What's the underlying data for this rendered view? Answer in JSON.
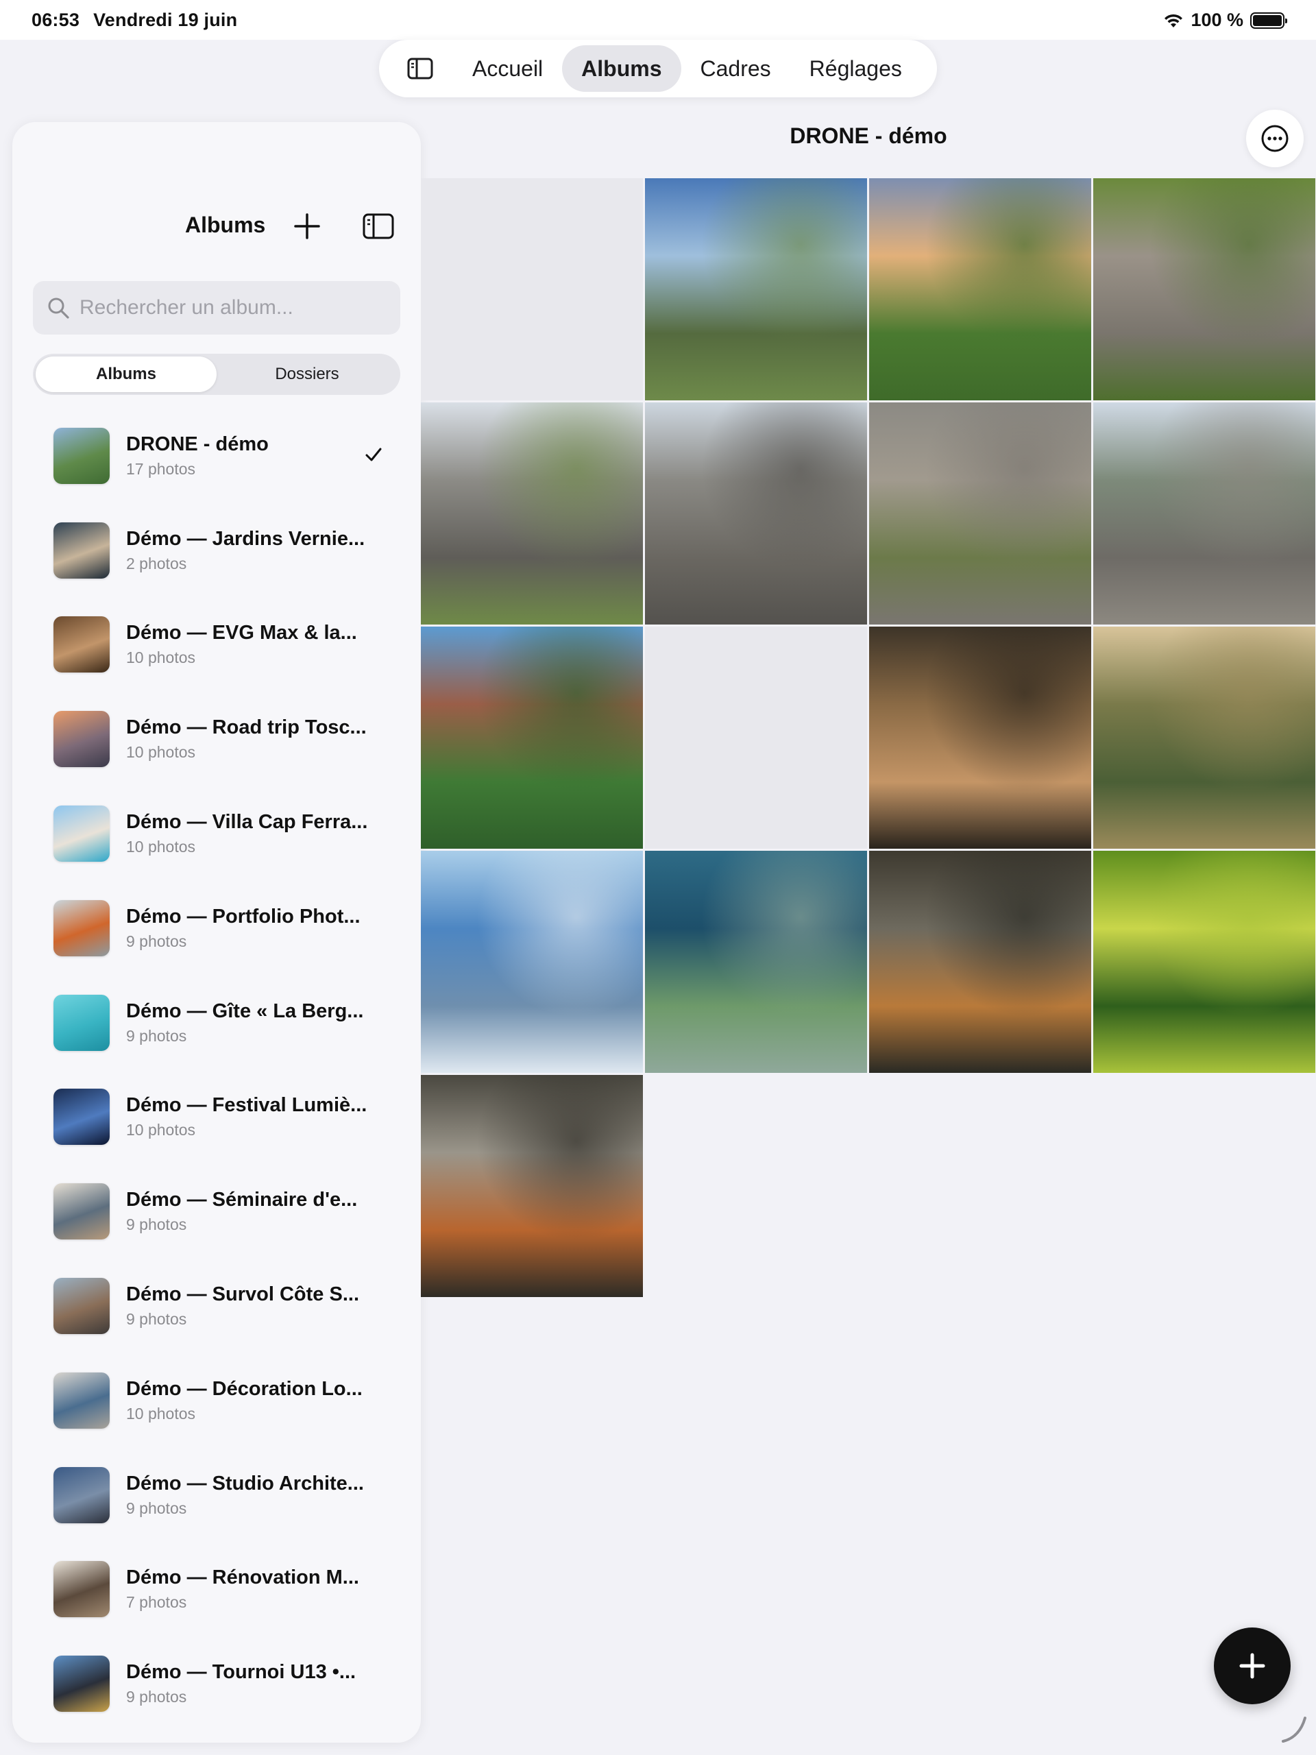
{
  "status_bar": {
    "time": "06:53",
    "date": "Vendredi 19 juin",
    "battery": "100 %"
  },
  "tabs": [
    {
      "label": "Accueil",
      "active": false
    },
    {
      "label": "Albums",
      "active": true
    },
    {
      "label": "Cadres",
      "active": false
    },
    {
      "label": "Réglages",
      "active": false
    }
  ],
  "sidebar": {
    "title": "Albums",
    "search_placeholder": "Rechercher un album...",
    "segments": [
      "Albums",
      "Dossiers"
    ],
    "albums": [
      {
        "name": "DRONE - démo",
        "count": "17 photos",
        "selected": true,
        "colors": [
          "#8fb3d9",
          "#5f8a4a",
          "#3f6b33"
        ]
      },
      {
        "name": "Démo — Jardins Vernie...",
        "count": "2 photos",
        "colors": [
          "#2f4253",
          "#c7b49a",
          "#1d2a36"
        ]
      },
      {
        "name": "Démo — EVG Max & la...",
        "count": "10 photos",
        "colors": [
          "#6b4a2e",
          "#c2956a",
          "#3a2817"
        ]
      },
      {
        "name": "Démo — Road trip Tosc...",
        "count": "10 photos",
        "colors": [
          "#e79b6a",
          "#7d6a78",
          "#3b3a4a"
        ]
      },
      {
        "name": "Démo — Villa Cap Ferra...",
        "count": "10 photos",
        "colors": [
          "#8ec6ee",
          "#e9e2d8",
          "#2ea7c9"
        ]
      },
      {
        "name": "Démo — Portfolio Phot...",
        "count": "9 photos",
        "colors": [
          "#c9d6dc",
          "#d0662c",
          "#8d9aa0"
        ]
      },
      {
        "name": "Démo — Gîte « La Berg...",
        "count": "9 photos",
        "colors": [
          "#6fd3de",
          "#39b4c3",
          "#1d8fa1"
        ]
      },
      {
        "name": "Démo — Festival Lumiè...",
        "count": "10 photos",
        "colors": [
          "#1a2d52",
          "#4f7bbf",
          "#0c1530"
        ]
      },
      {
        "name": "Démo — Séminaire d'e...",
        "count": "9 photos",
        "colors": [
          "#e5ded3",
          "#5d6e7e",
          "#b79a7b"
        ]
      },
      {
        "name": "Démo — Survol Côte S...",
        "count": "9 photos",
        "colors": [
          "#9ab0c2",
          "#8a6e58",
          "#3e3a38"
        ]
      },
      {
        "name": "Démo — Décoration Lo...",
        "count": "10 photos",
        "colors": [
          "#d9d5cf",
          "#4a6d8f",
          "#a8a29a"
        ]
      },
      {
        "name": "Démo — Studio Archite...",
        "count": "9 photos",
        "colors": [
          "#3a5a86",
          "#7a8ea8",
          "#2b2f3a"
        ]
      },
      {
        "name": "Démo — Rénovation M...",
        "count": "7 photos",
        "colors": [
          "#e7e1d7",
          "#5b4a3c",
          "#a08970"
        ]
      },
      {
        "name": "Démo — Tournoi U13 •...",
        "count": "9 photos",
        "colors": [
          "#5d8fc4",
          "#2a2f3a",
          "#c9a24a"
        ]
      }
    ]
  },
  "content": {
    "title": "DRONE - démo",
    "photos": [
      {
        "empty": true
      },
      {
        "colors": [
          "#4a79b8",
          "#9fbfdc",
          "#556b3f",
          "#6e8a4a"
        ]
      },
      {
        "colors": [
          "#7e8fb0",
          "#e2b07a",
          "#4a7a30",
          "#3f6b2a"
        ]
      },
      {
        "colors": [
          "#6b8a3c",
          "#9a9288",
          "#7a756d",
          "#4f6f2e"
        ]
      },
      {
        "colors": [
          "#d9dfe6",
          "#8c8b86",
          "#5f5d58",
          "#6f8a48"
        ]
      },
      {
        "colors": [
          "#cdd6df",
          "#8a8984",
          "#6a6761",
          "#54524e"
        ]
      },
      {
        "colors": [
          "#8c8a84",
          "#a19a8e",
          "#6c7a4a",
          "#7a7670"
        ]
      },
      {
        "colors": [
          "#cfd9e4",
          "#7d8a7a",
          "#6e6b66",
          "#8c8880"
        ]
      },
      {
        "colors": [
          "#5c9bd1",
          "#9a5e48",
          "#3f7a35",
          "#2f5f2a"
        ]
      },
      {
        "empty": true
      },
      {
        "colors": [
          "#3d3428",
          "#8a6a45",
          "#c49566",
          "#2a241c"
        ]
      },
      {
        "colors": [
          "#d8c49a",
          "#7a7a4a",
          "#4b5f36",
          "#9a8a5a"
        ]
      },
      {
        "colors": [
          "#a9cde9",
          "#4d86c2",
          "#6f8fae",
          "#dfe8f0"
        ]
      },
      {
        "colors": [
          "#2e6b86",
          "#1d4f6a",
          "#6e9a6a",
          "#8fa89a"
        ]
      },
      {
        "colors": [
          "#3e3a30",
          "#6e6a5e",
          "#b97a3a",
          "#2a2a24"
        ]
      },
      {
        "colors": [
          "#5f8f1e",
          "#c9d64a",
          "#2f5f1c",
          "#a8c23a"
        ]
      },
      {
        "colors": [
          "#4a4840",
          "#9a958a",
          "#b8652e",
          "#2e2c26"
        ]
      }
    ]
  }
}
